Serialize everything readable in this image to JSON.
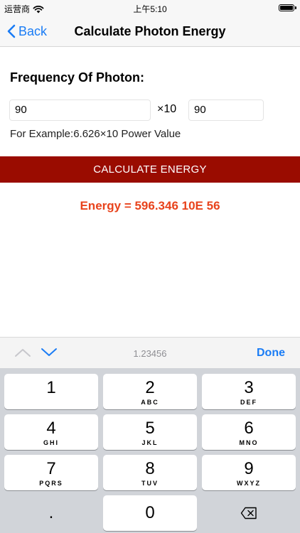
{
  "status_bar": {
    "carrier": "运营商",
    "time": "上午5:10",
    "wifi_icon": "wifi-icon",
    "battery_icon": "battery-icon"
  },
  "nav": {
    "back_label": "Back",
    "title": "Calculate Photon Energy",
    "back_icon": "chevron-left-icon",
    "accent_color": "#1a7cf5"
  },
  "form": {
    "section_label": "Frequency Of Photon:",
    "mantissa_value": "90",
    "times_label": "×10",
    "exponent_value": "90",
    "example_text": "For Example:6.626×10 Power Value"
  },
  "calculate_button": {
    "label": "CALCULATE ENERGY",
    "color": "#9a0c00"
  },
  "result": {
    "text": "Energy = 596.346 10E 56",
    "color": "#e8431c"
  },
  "keyboard_toolbar": {
    "preview": "1.23456",
    "done_label": "Done",
    "prev_icon": "chevron-up-icon",
    "next_icon": "chevron-down-icon"
  },
  "keypad": {
    "keys": [
      {
        "digit": "1",
        "letters": ""
      },
      {
        "digit": "2",
        "letters": "ABC"
      },
      {
        "digit": "3",
        "letters": "DEF"
      },
      {
        "digit": "4",
        "letters": "GHI"
      },
      {
        "digit": "5",
        "letters": "JKL"
      },
      {
        "digit": "6",
        "letters": "MNO"
      },
      {
        "digit": "7",
        "letters": "PQRS"
      },
      {
        "digit": "8",
        "letters": "TUV"
      },
      {
        "digit": "9",
        "letters": "WXYZ"
      }
    ],
    "decimal_label": ".",
    "zero_label": "0",
    "delete_icon": "backspace-icon"
  }
}
